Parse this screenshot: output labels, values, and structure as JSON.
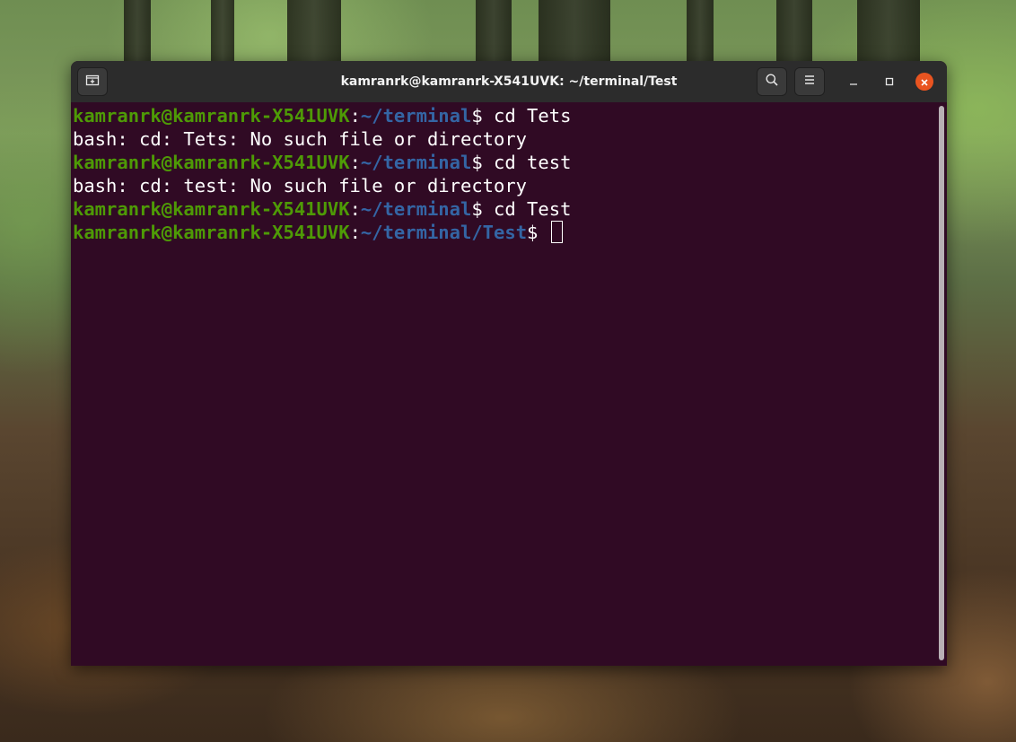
{
  "window": {
    "title": "kamranrk@kamranrk-X541UVK: ~/terminal/Test"
  },
  "titlebar": {
    "new_tab_icon": "new-tab-icon",
    "search_icon": "search-icon",
    "menu_icon": "hamburger-menu-icon",
    "minimize_icon": "minimize-icon",
    "maximize_icon": "maximize-icon",
    "close_icon": "close-icon"
  },
  "terminal": {
    "lines": [
      {
        "user": "kamranrk@kamranrk-X541UVK",
        "colon": ":",
        "path": "~/terminal",
        "prompt": "$ ",
        "command": "cd Tets"
      },
      {
        "output": "bash: cd: Tets: No such file or directory"
      },
      {
        "user": "kamranrk@kamranrk-X541UVK",
        "colon": ":",
        "path": "~/terminal",
        "prompt": "$ ",
        "command": "cd test"
      },
      {
        "output": "bash: cd: test: No such file or directory"
      },
      {
        "user": "kamranrk@kamranrk-X541UVK",
        "colon": ":",
        "path": "~/terminal",
        "prompt": "$ ",
        "command": "cd Test"
      },
      {
        "user": "kamranrk@kamranrk-X541UVK",
        "colon": ":",
        "path": "~/terminal/Test",
        "prompt": "$ ",
        "command": ""
      }
    ]
  },
  "colors": {
    "terminal_background": "#300a24",
    "prompt_user": "#4e9a06",
    "prompt_path": "#3465a4",
    "close_button": "#e95420",
    "titlebar": "#2c2c2c"
  }
}
